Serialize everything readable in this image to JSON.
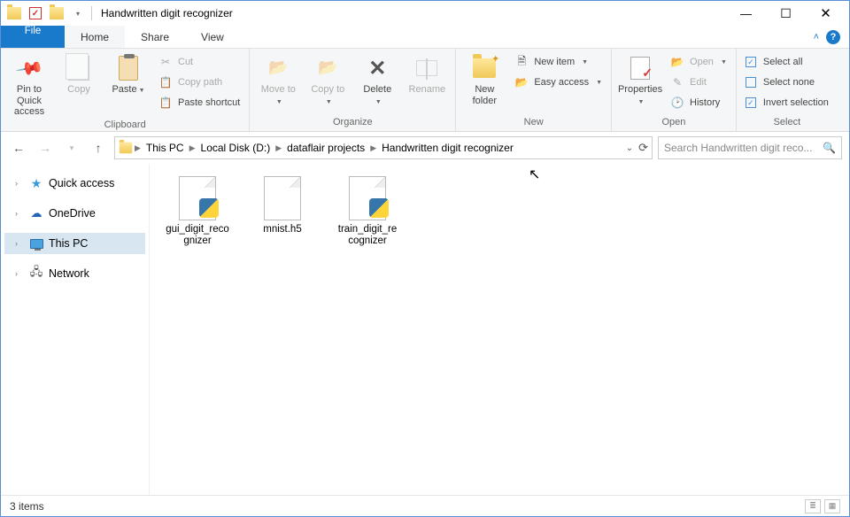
{
  "window": {
    "title": "Handwritten digit recognizer"
  },
  "tabs": {
    "file": "File",
    "home": "Home",
    "share": "Share",
    "view": "View"
  },
  "ribbon": {
    "clipboard": {
      "label": "Clipboard",
      "pin": "Pin to Quick access",
      "copy": "Copy",
      "paste": "Paste",
      "cut": "Cut",
      "copy_path": "Copy path",
      "paste_shortcut": "Paste shortcut"
    },
    "organize": {
      "label": "Organize",
      "move_to": "Move to",
      "copy_to": "Copy to",
      "delete": "Delete",
      "rename": "Rename"
    },
    "new": {
      "label": "New",
      "new_folder": "New folder",
      "new_item": "New item",
      "easy_access": "Easy access"
    },
    "open": {
      "label": "Open",
      "properties": "Properties",
      "open": "Open",
      "edit": "Edit",
      "history": "History"
    },
    "select": {
      "label": "Select",
      "select_all": "Select all",
      "select_none": "Select none",
      "invert": "Invert selection"
    }
  },
  "breadcrumb": {
    "this_pc": "This PC",
    "drive": "Local Disk (D:)",
    "folder1": "dataflair projects",
    "folder2": "Handwritten digit recognizer"
  },
  "search": {
    "placeholder": "Search Handwritten digit reco..."
  },
  "tree": {
    "quick_access": "Quick access",
    "onedrive": "OneDrive",
    "this_pc": "This PC",
    "network": "Network"
  },
  "files": [
    {
      "name": "gui_digit_recognizer",
      "type": "py"
    },
    {
      "name": "mnist.h5",
      "type": "plain"
    },
    {
      "name": "train_digit_recognizer",
      "type": "py"
    }
  ],
  "status": {
    "count": "3 items"
  }
}
